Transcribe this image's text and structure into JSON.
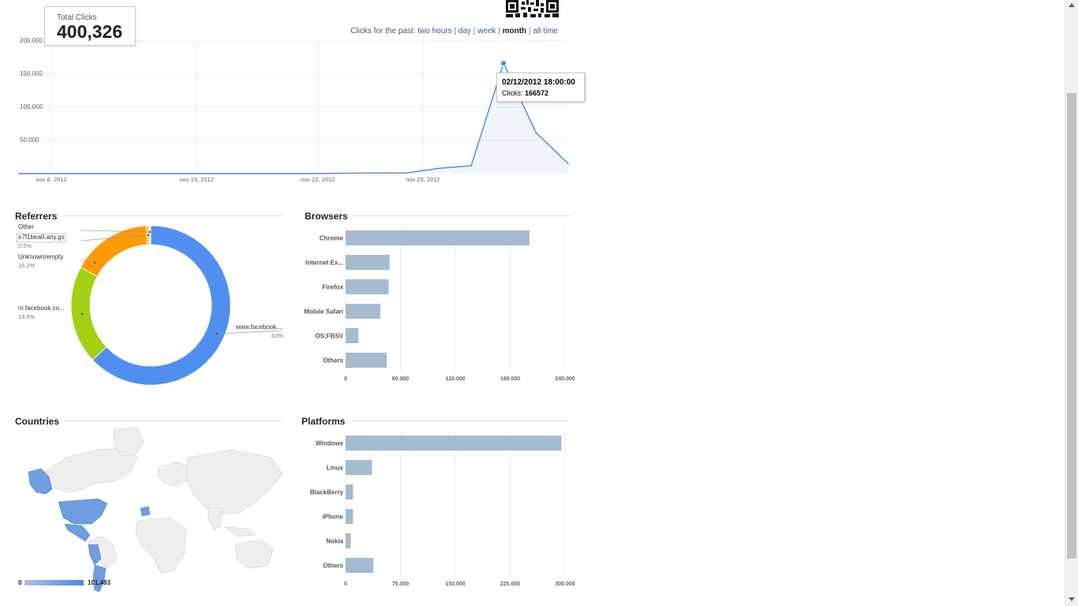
{
  "total_clicks": {
    "label": "Total Clicks",
    "value": "400,326"
  },
  "period_selector": {
    "prefix": "Clicks for the past:",
    "options": [
      "two hours",
      "day",
      "week",
      "month",
      "all time"
    ],
    "active": "month"
  },
  "tooltip": {
    "date": "02/12/2012 18:00:00",
    "clicks_label": "Clicks:",
    "clicks_value": "166572"
  },
  "sections": {
    "referrers": "Referrers",
    "browsers": "Browsers",
    "countries": "Countries",
    "platforms": "Platforms"
  },
  "colors": {
    "line": "#4a86e8",
    "bar": "#a5bbcf",
    "donut_blue": "#4f8ff0",
    "donut_green": "#a3d013",
    "donut_orange": "#ff9a00",
    "donut_yellow": "#f2c200",
    "map_fill": "#eeeeee",
    "map_highlight": "#6e9de0"
  },
  "map_legend": {
    "min": "0",
    "max": "101,483"
  },
  "chart_data": [
    {
      "type": "line",
      "name": "clicks-over-time",
      "x": [
        "nov 6, 2012",
        "nov 8, 2012",
        "nov 10, 2012",
        "nov 12, 2012",
        "nov 14, 2012",
        "nov 16, 2012",
        "nov 18, 2012",
        "nov 20, 2012",
        "nov 22, 2012",
        "nov 24, 2012",
        "nov 26, 2012",
        "nov 28, 2012",
        "nov 29, 2012",
        "nov 30, 2012",
        "dec 1, 2012",
        "dec 2, 2012",
        "dec 3, 2012",
        "dec 4, 2012"
      ],
      "y": [
        0,
        0,
        0,
        0,
        0,
        0,
        0,
        0,
        0,
        0,
        500,
        1000,
        1000,
        8000,
        12000,
        166572,
        62000,
        15000
      ],
      "x_ticks": [
        "nov 8, 2012",
        "nov 15, 2012",
        "nov 22, 2012",
        "nov 29, 2012"
      ],
      "y_ticks": [
        "50.000",
        "100.000",
        "150.000",
        "200.000"
      ],
      "ylim": [
        0,
        200000
      ],
      "grid": true
    },
    {
      "type": "pie",
      "name": "referrers",
      "categories": [
        "www.facebook....",
        "m.facebook.co...",
        "Unknown/empty",
        "e7f1bea0.any.gs",
        "Other"
      ],
      "values": [
        63,
        19.9,
        16.2,
        0.5,
        0.4
      ],
      "label_percents": [
        "63%",
        "19.9%",
        "16.2%",
        "0.5%",
        ""
      ]
    },
    {
      "type": "bar",
      "name": "browsers",
      "categories": [
        "Chrome",
        "Internet Ex...",
        "Firefox",
        "Mobile Safari",
        "OS;FBSV",
        "Others"
      ],
      "values": [
        201000,
        48000,
        47000,
        38000,
        14000,
        45000
      ],
      "x_ticks": [
        "0",
        "60.000",
        "120.000",
        "180.000",
        "240.000"
      ],
      "xlim": [
        0,
        240000
      ]
    },
    {
      "type": "bar",
      "name": "platforms",
      "categories": [
        "Windows",
        "Linux",
        "BlackBerry",
        "iPhone",
        "Nokia",
        "Others"
      ],
      "values": [
        295000,
        36000,
        10000,
        10000,
        7000,
        38000
      ],
      "x_ticks": [
        "0",
        "75.000",
        "150.000",
        "225.000",
        "300.000"
      ],
      "xlim": [
        0,
        300000
      ]
    }
  ]
}
